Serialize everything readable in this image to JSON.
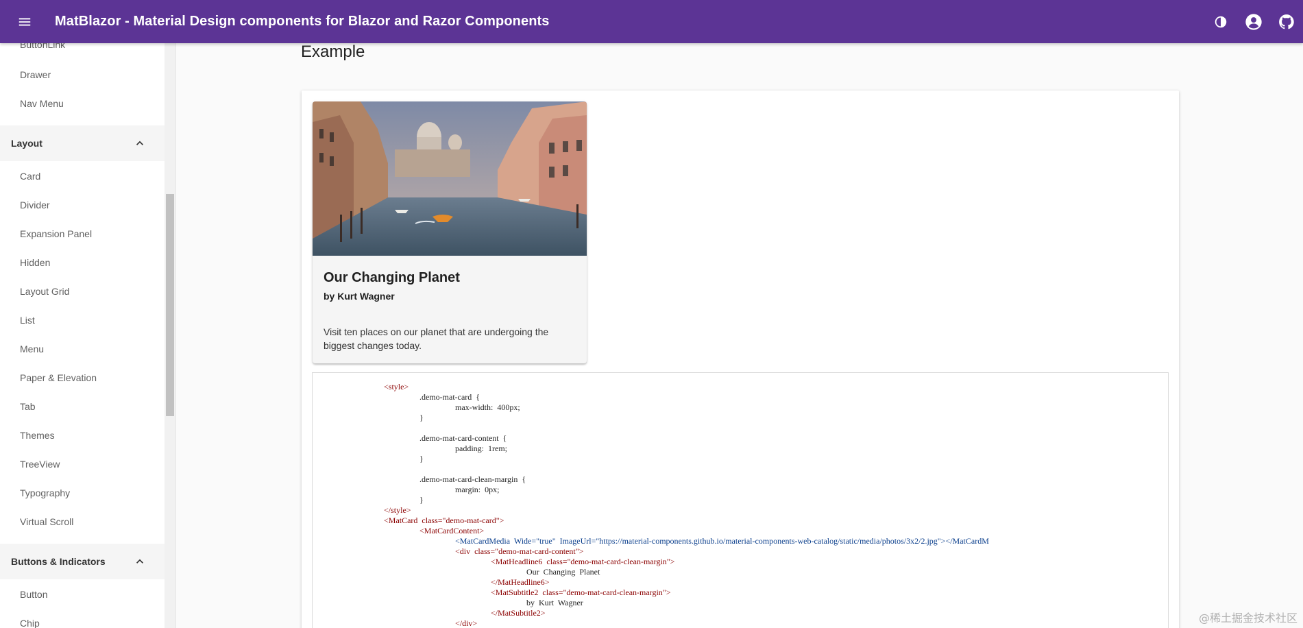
{
  "header": {
    "title": "MatBlazor - Material Design components for Blazor and Razor Components",
    "icons": [
      "menu-icon",
      "contrast-icon",
      "account-icon",
      "github-icon"
    ],
    "color": "#5c3495"
  },
  "sidebar": {
    "top_items": [
      "ButtonLink",
      "Drawer",
      "Nav Menu"
    ],
    "groups": [
      {
        "label": "Layout",
        "items": [
          "Card",
          "Divider",
          "Expansion Panel",
          "Hidden",
          "Layout Grid",
          "List",
          "Menu",
          "Paper & Elevation",
          "Tab",
          "Themes",
          "TreeView",
          "Typography",
          "Virtual Scroll"
        ]
      },
      {
        "label": "Buttons & Indicators",
        "items": [
          "Button",
          "Chip"
        ]
      }
    ]
  },
  "main": {
    "section_title": "Example",
    "card": {
      "headline": "Our Changing Planet",
      "subtitle": "by Kurt Wagner",
      "body": "Visit ten places on our planet that are undergoing the biggest changes today."
    },
    "code": {
      "lines": [
        "<style>",
        ".demo-mat-card  {",
        "max-width:  400px;",
        "}",
        "",
        ".demo-mat-card-content  {",
        "padding:  1rem;",
        "}",
        "",
        ".demo-mat-card-clean-margin  {",
        "margin:  0px;",
        "}",
        "</style>",
        "<MatCard  class=\"demo-mat-card\">",
        "<MatCardContent>",
        "<MatCardMedia  Wide=\"true\"  ImageUrl=\"https://material-components.github.io/material-components-web-catalog/static/media/photos/3x2/2.jpg\"></MatCardM",
        "<div  class=\"demo-mat-card-content\">",
        "<MatHeadline6  class=\"demo-mat-card-clean-margin\">",
        "Our  Changing  Planet",
        "</MatHeadline6>",
        "<MatSubtitle2  class=\"demo-mat-card-clean-margin\">",
        "by  Kurt  Wagner",
        "</MatSubtitle2>",
        "</div>"
      ]
    }
  },
  "watermark": "@稀土掘金技术社区"
}
